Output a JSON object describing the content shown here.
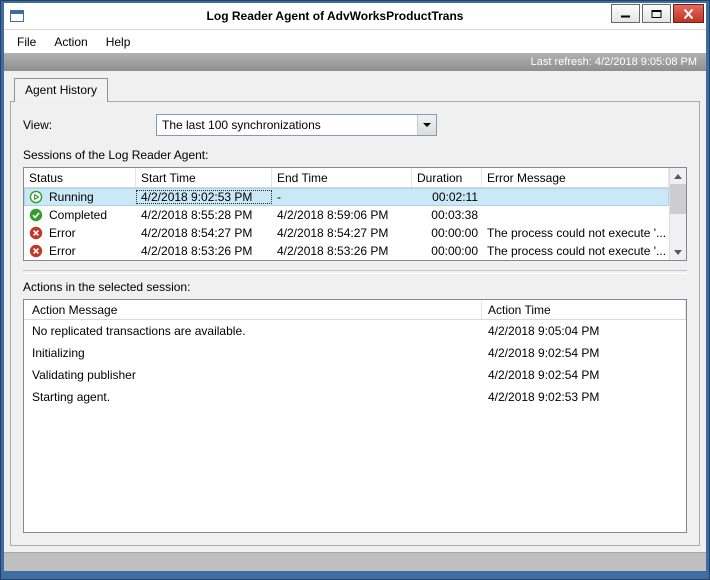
{
  "window": {
    "title": "Log Reader Agent of AdvWorksProductTrans"
  },
  "menu": {
    "file": "File",
    "action": "Action",
    "help": "Help"
  },
  "refresh_bar": {
    "text": "Last refresh: 4/2/2018 9:05:08 PM"
  },
  "tab": {
    "label": "Agent History"
  },
  "view": {
    "label": "View:",
    "value": "The last 100 synchronizations"
  },
  "sessions": {
    "label": "Sessions of the Log Reader Agent:",
    "columns": {
      "status": "Status",
      "start": "Start Time",
      "end": "End Time",
      "duration": "Duration",
      "error": "Error Message"
    },
    "rows": [
      {
        "status": "Running",
        "start": "4/2/2018 9:02:53 PM",
        "end": "-",
        "duration": "00:02:11",
        "error": ""
      },
      {
        "status": "Completed",
        "start": "4/2/2018 8:55:28 PM",
        "end": "4/2/2018 8:59:06 PM",
        "duration": "00:03:38",
        "error": ""
      },
      {
        "status": "Error",
        "start": "4/2/2018 8:54:27 PM",
        "end": "4/2/2018 8:54:27 PM",
        "duration": "00:00:00",
        "error": "The process could not execute '..."
      },
      {
        "status": "Error",
        "start": "4/2/2018 8:53:26 PM",
        "end": "4/2/2018 8:53:26 PM",
        "duration": "00:00:00",
        "error": "The process could not execute '..."
      }
    ]
  },
  "actions": {
    "label": "Actions in the selected session:",
    "columns": {
      "message": "Action Message",
      "time": "Action Time"
    },
    "rows": [
      {
        "message": "No replicated transactions are available.",
        "time": "4/2/2018 9:05:04 PM"
      },
      {
        "message": "Initializing",
        "time": "4/2/2018 9:02:54 PM"
      },
      {
        "message": "Validating publisher",
        "time": "4/2/2018 9:02:54 PM"
      },
      {
        "message": "Starting agent.",
        "time": "4/2/2018 9:02:53 PM"
      }
    ]
  },
  "colors": {
    "frame_blue": "#3E6DA6",
    "close_button_red": "#BE3425",
    "selection_blue": "#CBE8F6",
    "status_green": "#2E9E2E",
    "status_error_red": "#C0392B",
    "refresh_bar_gray": "#9B9B9B"
  }
}
